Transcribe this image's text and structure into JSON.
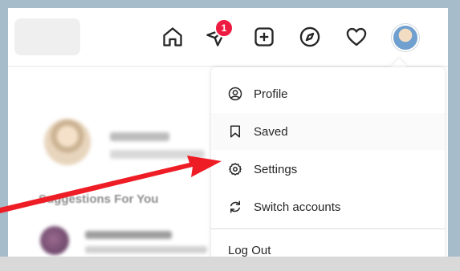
{
  "header": {
    "icons": [
      "home-icon",
      "direct-message-icon",
      "new-post-icon",
      "explore-icon",
      "activity-heart-icon",
      "profile-avatar"
    ],
    "dm_badge_count": "1"
  },
  "feed": {
    "suggestions_heading": "Suggestions For You"
  },
  "dropdown": {
    "items": [
      {
        "label": "Profile",
        "icon": "profile-icon"
      },
      {
        "label": "Saved",
        "icon": "bookmark-icon"
      },
      {
        "label": "Settings",
        "icon": "settings-icon"
      },
      {
        "label": "Switch accounts",
        "icon": "switch-accounts-icon"
      }
    ],
    "logout_label": "Log Out"
  },
  "annotation": {
    "arrow_color": "#ee1c25"
  }
}
